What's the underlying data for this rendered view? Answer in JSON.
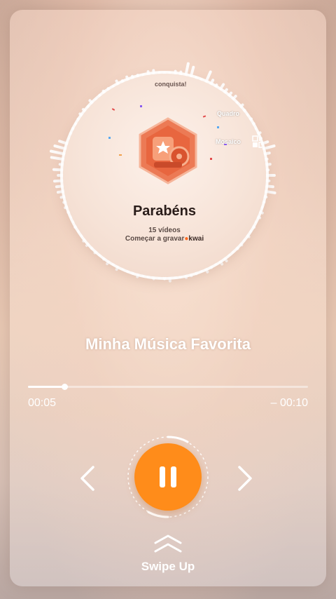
{
  "disc": {
    "top_text": "conquista!",
    "side_label_1": "Quadro",
    "side_label_2": "Mosaico",
    "headline": "Parabéns",
    "count_text": "15 vídeos",
    "cta_text": "Começar a gravar",
    "brand": "kwai"
  },
  "player": {
    "song_title": "Minha Música Favorita",
    "elapsed": "00:05",
    "remaining": "– 00:10",
    "progress_fraction": 0.13
  },
  "controls": {
    "prev_icon": "chevron-left-icon",
    "play_state_icon": "pause-icon",
    "next_icon": "chevron-right-icon"
  },
  "gesture": {
    "label": "Swipe Up",
    "icon": "double-chevron-up-icon"
  },
  "colors": {
    "accent": "#ff8c1a",
    "brand_kwai": "#ff6a1f"
  }
}
